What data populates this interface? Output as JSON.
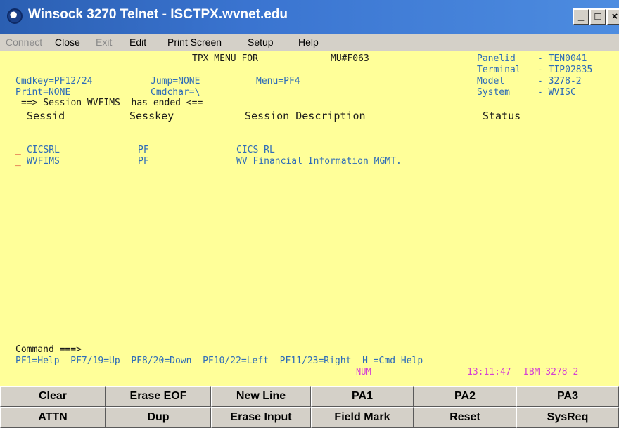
{
  "window": {
    "title": "Winsock 3270 Telnet - ISCTPX.wvnet.edu",
    "controls": {
      "minimize": "_",
      "maximize": "□",
      "close": "×"
    }
  },
  "menubar": {
    "items": [
      {
        "label": "Connect",
        "enabled": false
      },
      {
        "label": "Close",
        "enabled": true
      },
      {
        "label": "Exit",
        "enabled": false
      },
      {
        "label": "Edit",
        "enabled": true
      },
      {
        "label": "Print Screen",
        "enabled": true
      },
      {
        "label": "Setup",
        "enabled": true
      },
      {
        "label": "Help",
        "enabled": true
      }
    ]
  },
  "terminal": {
    "header": {
      "menu_title": "TPX MENU FOR",
      "menu_id": "MU#F063",
      "panelid_label": "Panelid",
      "panelid_value": "- TEN0041",
      "terminal_label": "Terminal",
      "terminal_value": "- TIP02835",
      "model_label": "Model",
      "model_value": "- 3278-2",
      "system_label": "System",
      "system_value": "- WVISC",
      "cmdkey": "Cmdkey=PF12/24",
      "jump": "Jump=NONE",
      "menu": "Menu=PF4",
      "print": "Print=NONE",
      "cmdchar": "Cmdchar=\\"
    },
    "message": "==> Session WVFIMS  has ended <==",
    "columns": {
      "sessid": "Sessid",
      "sesskey": "Sesskey",
      "description": "Session Description",
      "status": "Status"
    },
    "sessions": [
      {
        "select": "_",
        "sessid": "CICSRL",
        "sesskey": "PF",
        "description": "CICS RL",
        "status": ""
      },
      {
        "select": "_",
        "sessid": "WVFIMS",
        "sesskey": "PF",
        "description": "WV Financial Information MGMT.",
        "status": ""
      }
    ],
    "command_label": "Command ===>",
    "command_value": "",
    "pf_help": "PF1=Help  PF7/19=Up  PF8/20=Down  PF10/22=Left  PF11/23=Right  H =Cmd Help",
    "status": {
      "num": "NUM",
      "time": "13:11:47",
      "model": "IBM-3278-2"
    }
  },
  "buttons": {
    "row1": [
      "Clear",
      "Erase EOF",
      "New Line",
      "PA1",
      "PA2",
      "PA3"
    ],
    "row2": [
      "ATTN",
      "Dup",
      "Erase Input",
      "Field Mark",
      "Reset",
      "SysReq"
    ]
  }
}
